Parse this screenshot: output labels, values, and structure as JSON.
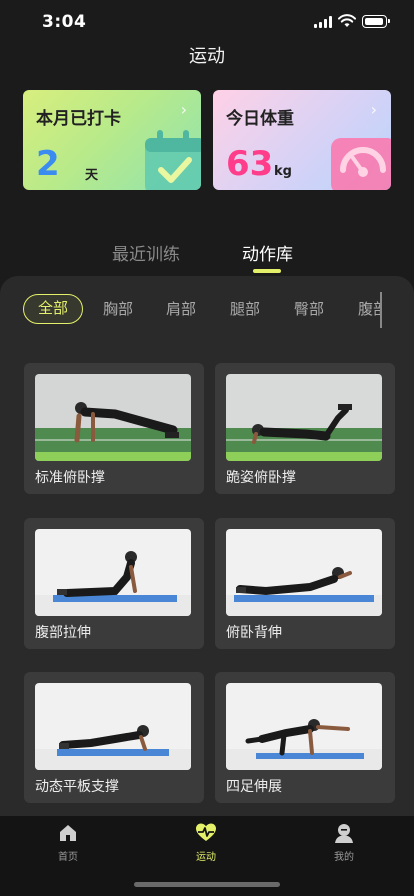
{
  "status_bar": {
    "time": "3:04"
  },
  "nav": {
    "title": "运动"
  },
  "stats": {
    "checkin": {
      "title": "本月已打卡",
      "value": "2",
      "unit": "天",
      "chevron": "›"
    },
    "weight": {
      "title": "今日体重",
      "value": "63",
      "unit": "kg",
      "chevron": "›"
    }
  },
  "tabs": [
    {
      "label": "最近训练",
      "active": false
    },
    {
      "label": "动作库",
      "active": true
    }
  ],
  "filters": [
    "全部",
    "胸部",
    "肩部",
    "腿部",
    "臀部",
    "腹部"
  ],
  "exercises": [
    {
      "name": "标准俯卧撑",
      "floor": "green"
    },
    {
      "name": "跪姿俯卧撑",
      "floor": "green"
    },
    {
      "name": "腹部拉伸",
      "floor": "mat"
    },
    {
      "name": "俯卧背伸",
      "floor": "mat"
    },
    {
      "name": "动态平板支撑",
      "floor": "mat"
    },
    {
      "name": "四足伸展",
      "floor": "mat"
    }
  ],
  "tabbar": [
    {
      "label": "首页",
      "icon": "home-icon",
      "active": false
    },
    {
      "label": "运动",
      "icon": "pulse-heart-icon",
      "active": true
    },
    {
      "label": "我的",
      "icon": "profile-icon",
      "active": false
    }
  ],
  "colors": {
    "accent": "#e4f06a",
    "checkin_value": "#3a8cf0",
    "weight_value": "#ff3d8a",
    "background": "#1b1b1b"
  }
}
